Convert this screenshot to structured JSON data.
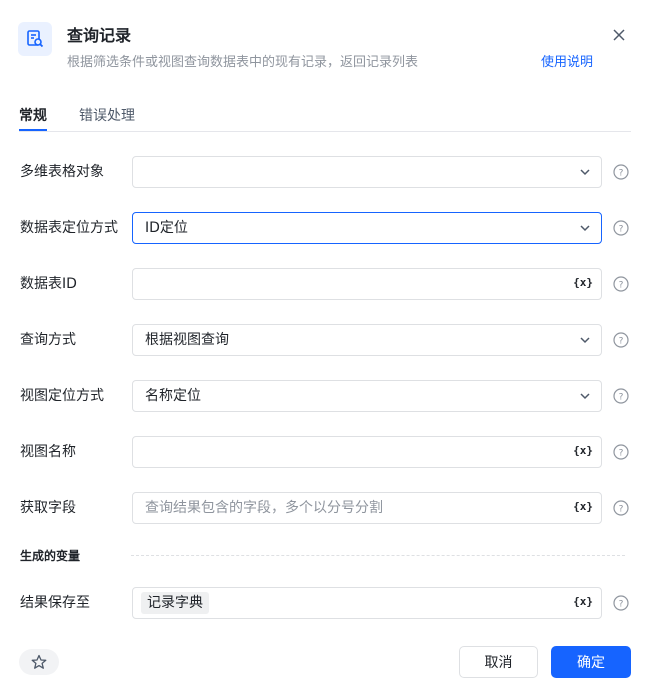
{
  "header": {
    "title": "查询记录",
    "subtitle": "根据筛选条件或视图查询数据表中的现有记录，返回记录列表",
    "help_link": "使用说明",
    "icon": "table-search-icon"
  },
  "tabs": [
    {
      "label": "常规",
      "active": true
    },
    {
      "label": "错误处理",
      "active": false
    }
  ],
  "fields": {
    "table_object": {
      "label": "多维表格对象",
      "value": ""
    },
    "locate_method": {
      "label": "数据表定位方式",
      "value": "ID定位"
    },
    "table_id": {
      "label": "数据表ID",
      "value": ""
    },
    "query_method": {
      "label": "查询方式",
      "value": "根据视图查询"
    },
    "view_locate": {
      "label": "视图定位方式",
      "value": "名称定位"
    },
    "view_name": {
      "label": "视图名称",
      "value": ""
    },
    "get_fields": {
      "label": "获取字段",
      "placeholder": "查询结果包含的字段，多个以分号分割"
    },
    "save_to": {
      "label": "结果保存至",
      "tag": "记录字典"
    }
  },
  "var_button": "{x}",
  "section": {
    "generated_vars": "生成的变量"
  },
  "footer": {
    "cancel": "取消",
    "confirm": "确定"
  },
  "colors": {
    "accent": "#1664ff",
    "border": "#dee0e3",
    "text": "#1f2329",
    "muted": "#8f959e"
  }
}
